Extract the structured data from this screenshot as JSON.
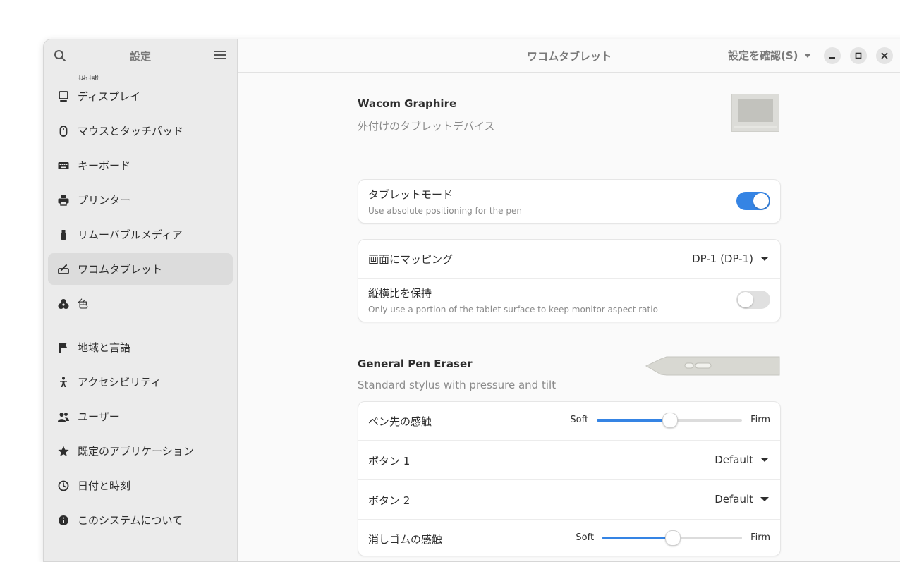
{
  "sidebar": {
    "title": "設定",
    "items": [
      {
        "label": "地域",
        "icon": "location-icon",
        "partial": true
      },
      {
        "label": "ディスプレイ",
        "icon": "display-icon"
      },
      {
        "label": "マウスとタッチパッド",
        "icon": "mouse-icon"
      },
      {
        "label": "キーボード",
        "icon": "keyboard-icon"
      },
      {
        "label": "プリンター",
        "icon": "printer-icon"
      },
      {
        "label": "リムーバブルメディア",
        "icon": "usb-icon"
      },
      {
        "label": "ワコムタブレット",
        "icon": "tablet-icon",
        "active": true
      },
      {
        "label": "色",
        "icon": "color-icon"
      }
    ],
    "items2": [
      {
        "label": "地域と言語",
        "icon": "flag-icon"
      },
      {
        "label": "アクセシビリティ",
        "icon": "accessibility-icon"
      },
      {
        "label": "ユーザー",
        "icon": "users-icon"
      },
      {
        "label": "既定のアプリケーション",
        "icon": "star-icon"
      },
      {
        "label": "日付と時刻",
        "icon": "clock-icon"
      },
      {
        "label": "このシステムについて",
        "icon": "info-icon"
      }
    ]
  },
  "header": {
    "title": "ワコムタブレット",
    "check_label": "設定を確認(S)"
  },
  "tablet": {
    "name": "Wacom Graphire",
    "subtitle": "外付けのタブレットデバイス",
    "mode_title": "タブレットモード",
    "mode_desc": "Use absolute positioning for the pen",
    "mode_on": true,
    "map_title": "画面にマッピング",
    "map_value": "DP-1 (DP-1)",
    "aspect_title": "縦横比を保持",
    "aspect_desc": "Only use a portion of the tablet surface to keep monitor aspect ratio",
    "aspect_on": false
  },
  "stylus": {
    "name": "General Pen Eraser",
    "subtitle": "Standard stylus with pressure and tilt",
    "tip_title": "ペン先の感触",
    "tip_soft": "Soft",
    "tip_firm": "Firm",
    "tip_level": 0.5,
    "button1_title": "ボタン 1",
    "button1_value": "Default",
    "button2_title": "ボタン 2",
    "button2_value": "Default",
    "eraser_title": "消しゴムの感触",
    "eraser_soft": "Soft",
    "eraser_firm": "Firm",
    "eraser_level": 0.5
  },
  "colors": {
    "accent": "#3584e4"
  }
}
